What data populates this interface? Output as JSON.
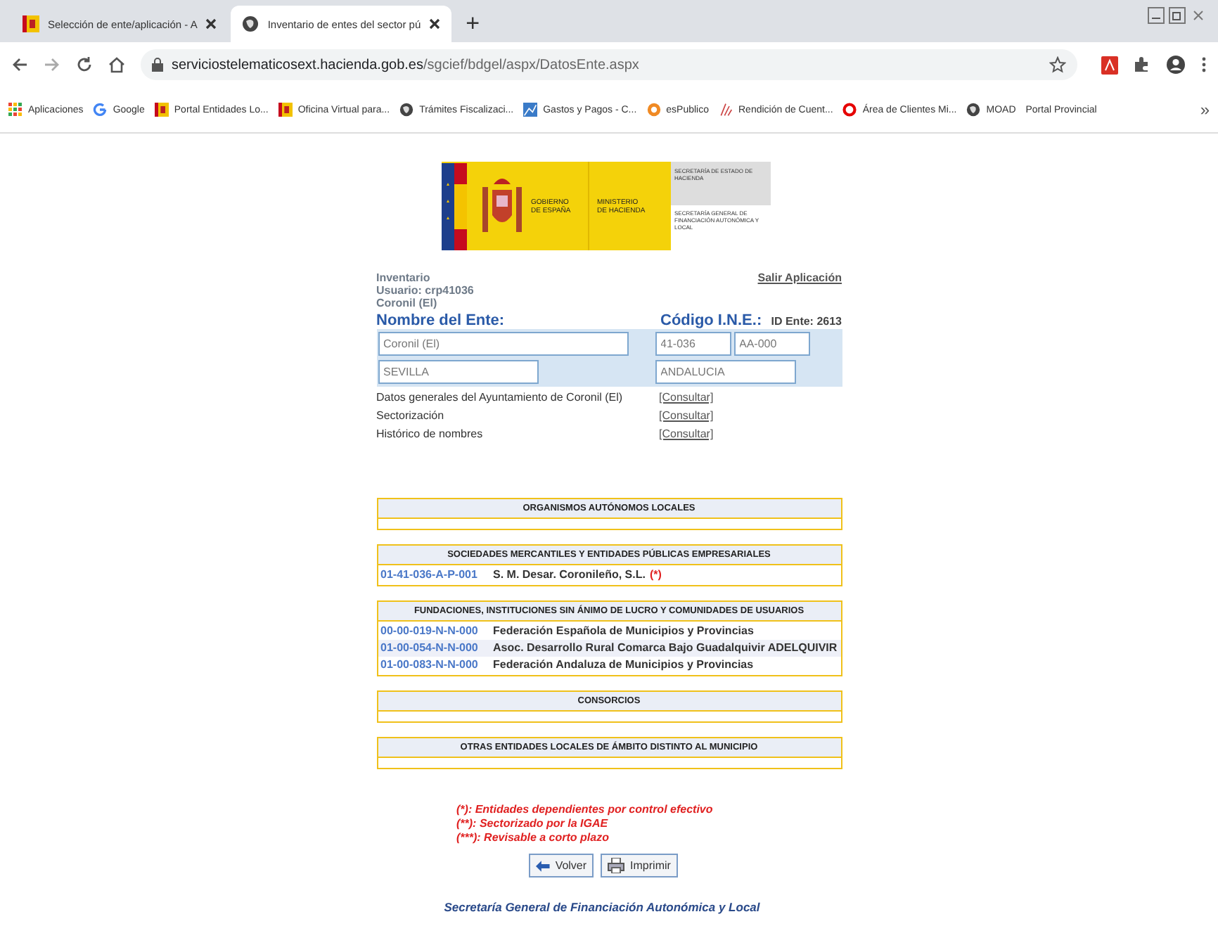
{
  "browser": {
    "tabs": [
      {
        "title": "Selección de ente/aplicación - A",
        "kind": "flag",
        "selected": false
      },
      {
        "title": "Inventario de entes del sector pú",
        "kind": "globe",
        "selected": true
      }
    ],
    "new_tab": "+",
    "url_host": "serviciostelematicosext.hacienda.gob.es",
    "url_path": "/sgcief/bdgel/aspx/DatosEnte.aspx",
    "bookmarks": [
      {
        "label": "Aplicaciones",
        "kind": "apps"
      },
      {
        "label": "Google",
        "kind": "google"
      },
      {
        "label": "Portal Entidades Lo...",
        "kind": "flag"
      },
      {
        "label": "Oficina Virtual para...",
        "kind": "flag"
      },
      {
        "label": "Trámites Fiscalizaci...",
        "kind": "globe"
      },
      {
        "label": "Gastos y Pagos - C...",
        "kind": "chart"
      },
      {
        "label": "esPublico",
        "kind": "orange"
      },
      {
        "label": "Rendición de Cuent...",
        "kind": "rc"
      },
      {
        "label": "Área de Clientes Mi...",
        "kind": "ring"
      },
      {
        "label": "MOAD",
        "kind": "globe"
      },
      {
        "label": "Portal Provincial",
        "kind": "none"
      }
    ],
    "more": "»"
  },
  "logo": {
    "left_top": "GOBIERNO",
    "left_bottom": "DE ESPAÑA",
    "mid_top": "MINISTERIO",
    "mid_bottom": "DE HACIENDA",
    "right_top": "SECRETARÍA DE ESTADO DE HACIENDA",
    "right_bottom": "SECRETARÍA GENERAL DE FINANCIACIÓN AUTONÓMICA Y LOCAL"
  },
  "header": {
    "app": "Inventario",
    "user": "Usuario: crp41036",
    "entity": "Coronil (El)",
    "logout": "Salir Aplicación"
  },
  "entity": {
    "name_label": "Nombre del Ente:",
    "code_label": "Código I.N.E.:",
    "id": "ID Ente: 2613",
    "name": "Coronil (El)",
    "code": "41-036",
    "code2": "AA-000",
    "province": "SEVILLA",
    "region": "ANDALUCIA"
  },
  "links": [
    {
      "label": "Datos generales del Ayuntamiento de Coronil (El)",
      "action": "[Consultar]"
    },
    {
      "label": "Sectorización",
      "action": "[Consultar]"
    },
    {
      "label": "Histórico de nombres",
      "action": "[Consultar]"
    }
  ],
  "sections": [
    {
      "title": "ORGANISMOS AUTÓNOMOS LOCALES"
    },
    {
      "title": "SOCIEDADES MERCANTILES Y ENTIDADES PÚBLICAS EMPRESARIALES",
      "rows": [
        {
          "code": "01-41-036-A-P-001",
          "name": "S. M. Desar. Coronileño, S.L.",
          "note": "(*)",
          "highlighted": false
        }
      ]
    },
    {
      "title": "FUNDACIONES, INSTITUCIONES SIN ÁNIMO DE LUCRO Y COMUNIDADES DE USUARIOS",
      "rows": [
        {
          "code": "00-00-019-N-N-000",
          "name": "Federación Española de Municipios y Provincias",
          "highlighted": false
        },
        {
          "code": "01-00-054-N-N-000",
          "name": "Asoc. Desarrollo Rural Comarca Bajo Guadalquivir ADELQUIVIR",
          "highlighted": true
        },
        {
          "code": "01-00-083-N-N-000",
          "name": "Federación Andaluza de Municipios y Provincias",
          "highlighted": false
        }
      ]
    },
    {
      "title": "CONSORCIOS"
    },
    {
      "title": "OTRAS ENTIDADES LOCALES DE ÁMBITO DISTINTO AL MUNICIPIO"
    }
  ],
  "notes": [
    "(*): Entidades dependientes por control efectivo",
    "(**): Sectorizado por la IGAE",
    "(***): Revisable a corto plazo"
  ],
  "buttons": [
    {
      "label": "Volver",
      "kind": "back"
    },
    {
      "label": "Imprimir",
      "kind": "print"
    }
  ],
  "footer": "Secretaría General de Financiación Autonómica y Local"
}
